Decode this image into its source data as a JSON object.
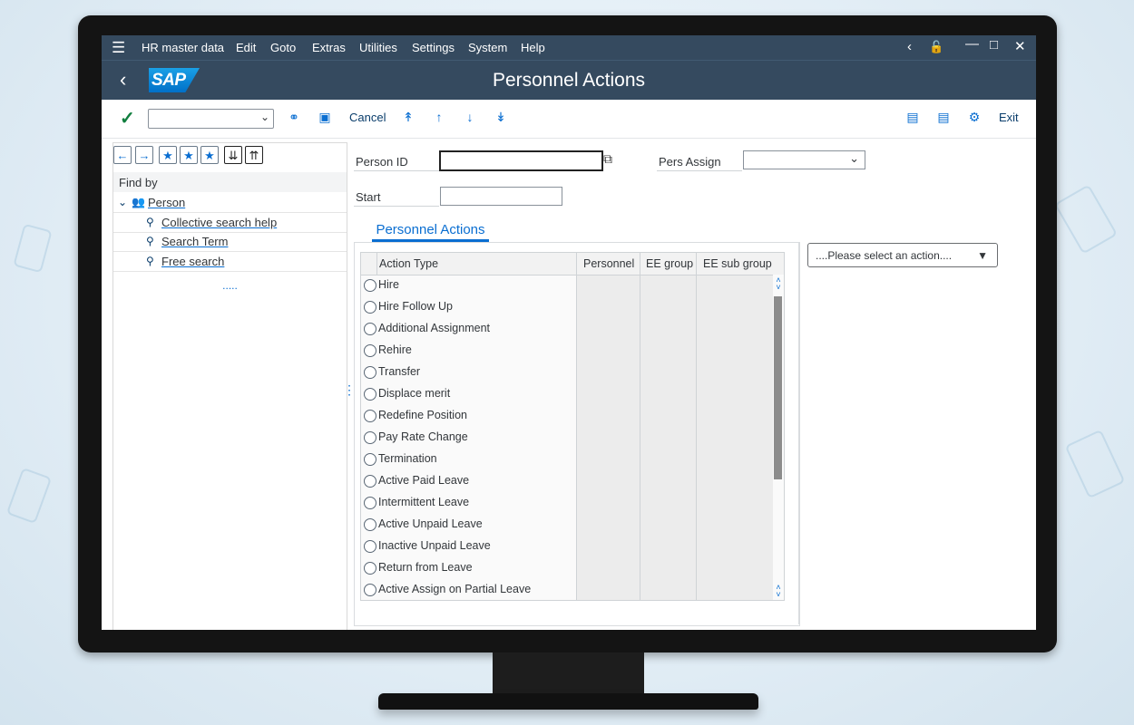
{
  "menubar": {
    "items": [
      "HR master data",
      "Edit",
      "Goto",
      "Extras",
      "Utilities",
      "Settings",
      "System",
      "Help"
    ]
  },
  "titlebar": {
    "logo": "SAP",
    "title": "Personnel Actions"
  },
  "toolbar": {
    "command_field_value": "",
    "cancel_label": "Cancel",
    "exit_label": "Exit"
  },
  "left_panel": {
    "find_by_label": "Find by",
    "tree": {
      "root": "Person",
      "children": [
        "Collective search help",
        "Search Term",
        "Free search"
      ]
    },
    "more_indicator": "....."
  },
  "fields": {
    "person_id_label": "Person ID",
    "person_id_value": "",
    "pers_assign_label": "Pers Assign",
    "pers_assign_value": "",
    "start_label": "Start",
    "start_value": ""
  },
  "tabs": {
    "personnel_actions": "Personnel Actions"
  },
  "table": {
    "headers": [
      "Action Type",
      "Personnel",
      "EE group",
      "EE sub group"
    ],
    "rows": [
      "Hire",
      "Hire Follow Up",
      "Additional Assignment",
      "Rehire",
      "Transfer",
      "Displace merit",
      "Redefine Position",
      "Pay Rate Change",
      "Termination",
      "Active Paid Leave",
      "Intermittent Leave",
      "Active Unpaid Leave",
      "Inactive Unpaid Leave",
      "Return from Leave",
      "Active Assign on Partial Leave"
    ]
  },
  "action_select": {
    "value": "....Please select an action...."
  },
  "colors": {
    "shell_header": "#354a5f",
    "accent_blue": "#0a6ed1",
    "check_green": "#107e3e"
  },
  "icons": [
    "menu-icon",
    "back-icon",
    "lock-icon",
    "minimize-icon",
    "maximize-icon",
    "close-icon",
    "check-icon",
    "binoculars-icon",
    "image-icon",
    "first-page-icon",
    "previous-page-icon",
    "next-page-icon",
    "last-page-icon",
    "new-window-icon",
    "session-icon",
    "settings-icon"
  ]
}
